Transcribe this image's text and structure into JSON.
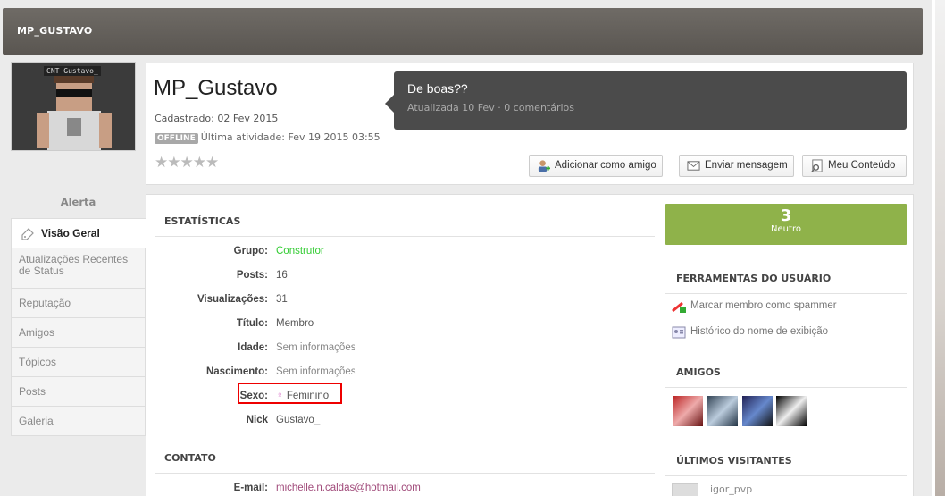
{
  "header": {
    "title": "MP_GUSTAVO"
  },
  "avatar": {
    "tag": "CNT Gustavo_"
  },
  "profile": {
    "name": "MP_Gustavo",
    "registered": "Cadastrado: 02 Fev 2015",
    "status_badge": "OFFLINE",
    "last_activity": "Última atividade: Fev 19 2015 03:55",
    "rating_stars": 0
  },
  "status_update": {
    "text": "De boas??",
    "meta": "Atualizada 10 Fev · 0 comentários"
  },
  "actions": {
    "add_friend": "Adicionar como amigo",
    "send_message": "Enviar mensagem",
    "my_content": "Meu Conteúdo"
  },
  "sidebar": {
    "alert": "Alerta",
    "items": [
      {
        "label": "Visão Geral"
      },
      {
        "label": "Atualizações Recentes de Status"
      },
      {
        "label": "Reputação"
      },
      {
        "label": "Amigos"
      },
      {
        "label": "Tópicos"
      },
      {
        "label": "Posts"
      },
      {
        "label": "Galeria"
      }
    ]
  },
  "stats": {
    "heading": "ESTATÍSTICAS",
    "rows": [
      {
        "label": "Grupo:",
        "value": "Construtor"
      },
      {
        "label": "Posts:",
        "value": "16"
      },
      {
        "label": "Visualizações:",
        "value": "31"
      },
      {
        "label": "Título:",
        "value": "Membro"
      },
      {
        "label": "Idade:",
        "value": "Sem informações"
      },
      {
        "label": "Nascimento:",
        "value": "Sem informações"
      },
      {
        "label": "Sexo:",
        "value": "Feminino"
      },
      {
        "label": "Nick",
        "value": "Gustavo_"
      }
    ]
  },
  "contact": {
    "heading": "CONTATO",
    "email_label": "E-mail:",
    "email_value": "michelle.n.caldas@hotmail.com"
  },
  "reputation": {
    "value": "3",
    "label": "Neutro"
  },
  "user_tools": {
    "heading": "FERRAMENTAS DO USUÁRIO",
    "mark_spammer": "Marcar membro como spammer",
    "name_history": "Histórico do nome de exibição"
  },
  "friends": {
    "heading": "AMIGOS"
  },
  "visitors": {
    "heading": "ÚLTIMOS VISITANTES",
    "first": "igor_pvp"
  },
  "colors": {
    "header_bg": "#5f5b56",
    "reputation_bg": "#8fb24a",
    "highlight": "#e00000"
  }
}
